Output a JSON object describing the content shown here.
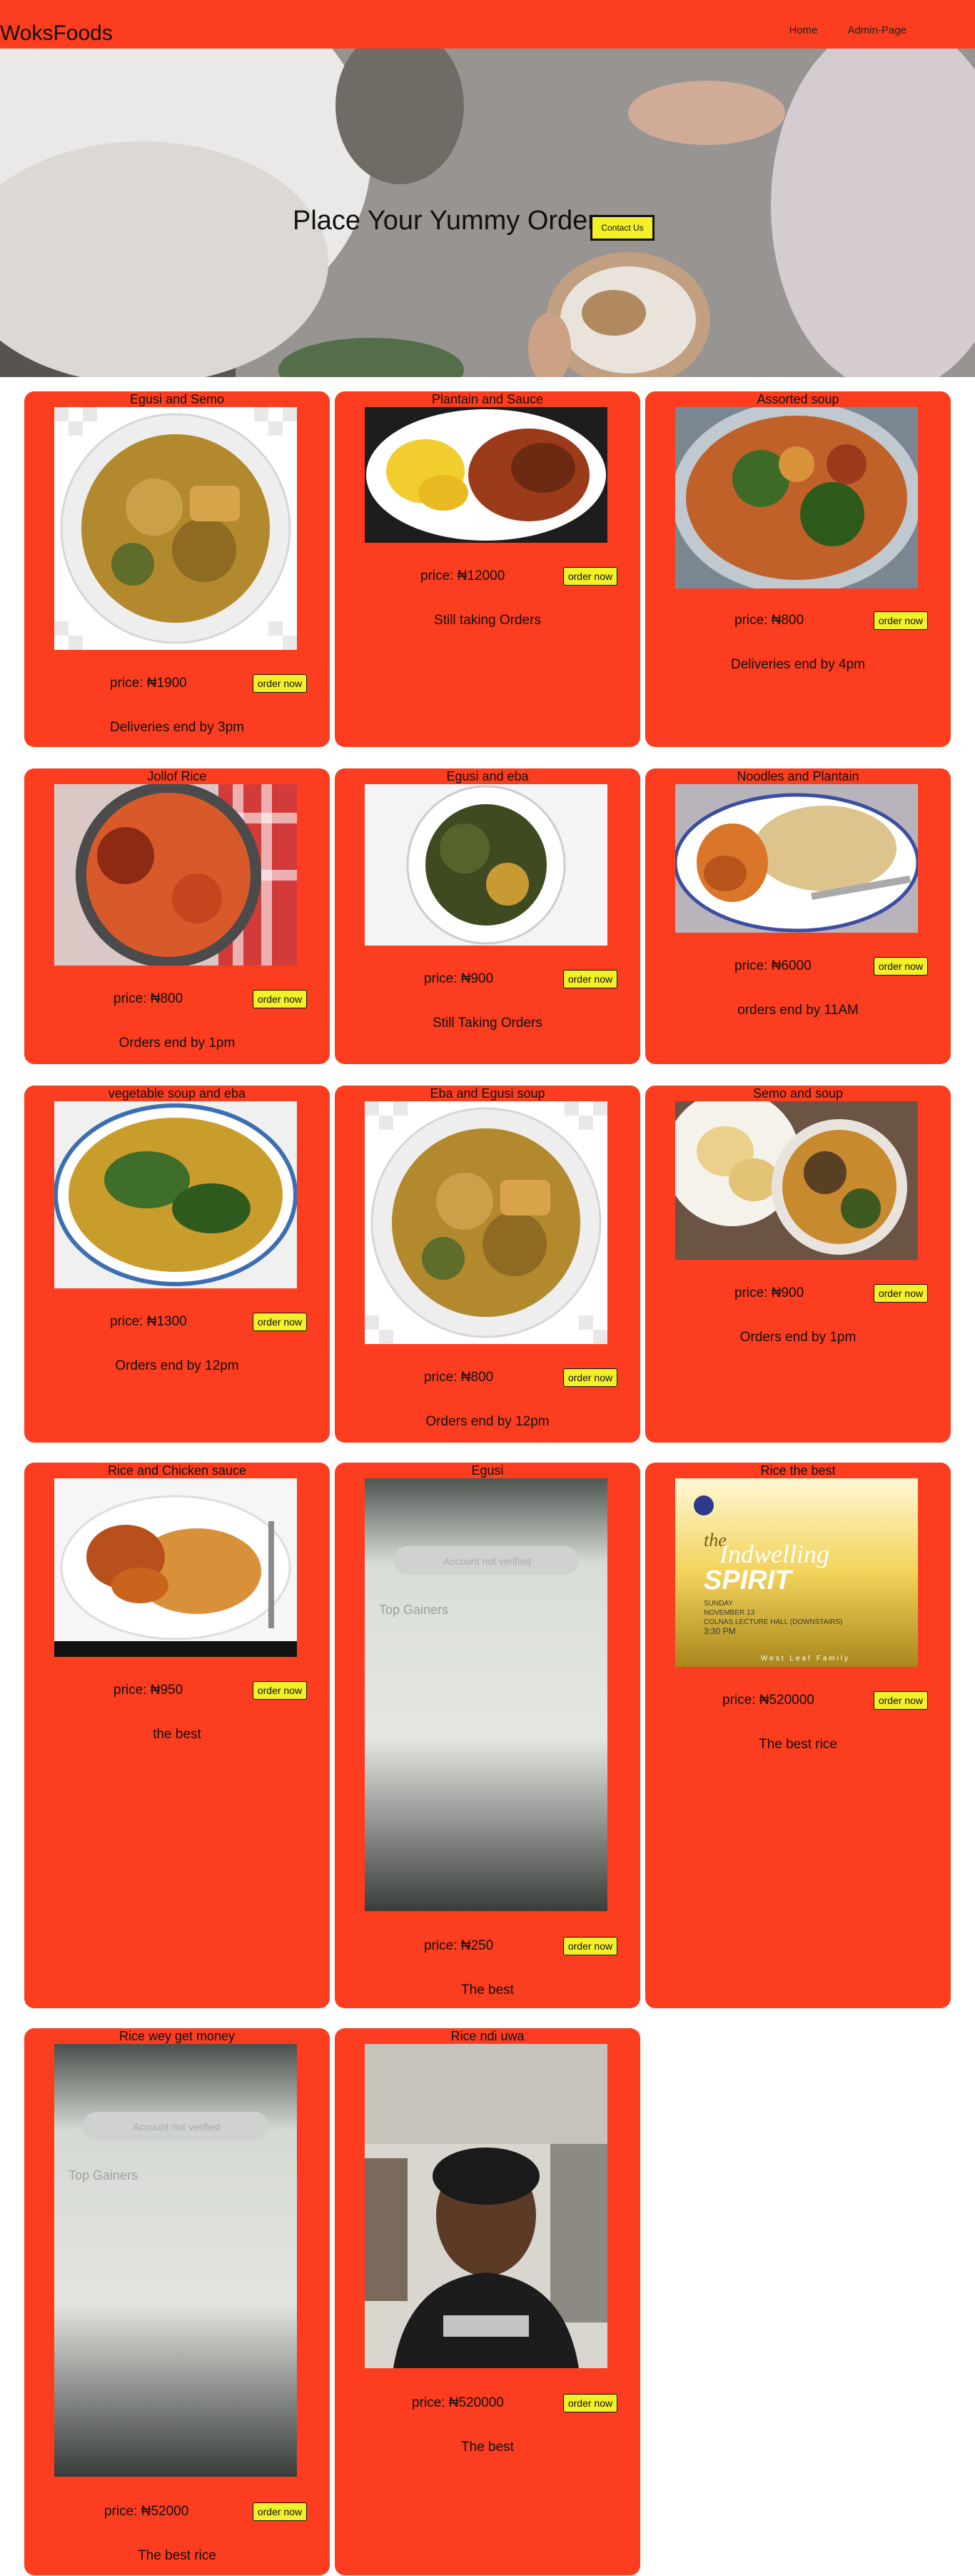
{
  "header": {
    "brand": "WoksFoods",
    "nav": [
      {
        "label": "Home"
      },
      {
        "label": "Admin-Page"
      }
    ]
  },
  "hero": {
    "title": "Place Your Yummy Order",
    "contact_label": "Contact Us"
  },
  "order_label": "order now",
  "products": [
    {
      "name": "Egusi and Semo",
      "price": "price: ₦1900",
      "note": "Deliveries end by 3pm"
    },
    {
      "name": "Plantain and Sauce",
      "price": "price: ₦12000",
      "note": "Still taking Orders"
    },
    {
      "name": "Assorted soup",
      "price": "price: ₦800",
      "note": "Deliveries end by 4pm"
    },
    {
      "name": "Jollof Rice",
      "price": "price: ₦800",
      "note": "Orders end by 1pm"
    },
    {
      "name": "Egusi and eba",
      "price": "price: ₦900",
      "note": "Still Taking Orders"
    },
    {
      "name": "Noodles and Plantain",
      "price": "price: ₦6000",
      "note": "orders end by 11AM"
    },
    {
      "name": "vegetable soup and eba",
      "price": "price: ₦1300",
      "note": "Orders end by 12pm"
    },
    {
      "name": "Eba and Egusi soup",
      "price": "price: ₦800",
      "note": "Orders end by 12pm"
    },
    {
      "name": "Semo and soup",
      "price": "price: ₦900",
      "note": "Orders end by 1pm"
    },
    {
      "name": "Rice and Chicken sauce",
      "price": "price: ₦950",
      "note": "the best"
    },
    {
      "name": "Egusi",
      "price": "price: ₦250",
      "note": "The best"
    },
    {
      "name": "Rice the best",
      "price": "price: ₦520000",
      "note": "The best rice"
    },
    {
      "name": "Rice wey get money",
      "price": "price: ₦52000",
      "note": "The best rice"
    },
    {
      "name": "Rice ndi uwa",
      "price": "price: ₦520000",
      "note": "The best"
    }
  ],
  "poster": {
    "the": "the",
    "title": "Indwelling",
    "subtitle": "SPIRIT",
    "day": "SUNDAY",
    "date": "NOVEMBER 13",
    "venue": "COLNAS LECTURE HALL (DOWNSTAIRS)",
    "time": "3:30 PM",
    "footer": "West Leaf Family"
  },
  "screenshot_text": {
    "heading": "Top Gainers",
    "search": "Account not verified"
  },
  "colors": {
    "nav_bg": "#fc3d1f",
    "card_bg": "#fc3d1f",
    "button_bg": "#f3f02a"
  }
}
